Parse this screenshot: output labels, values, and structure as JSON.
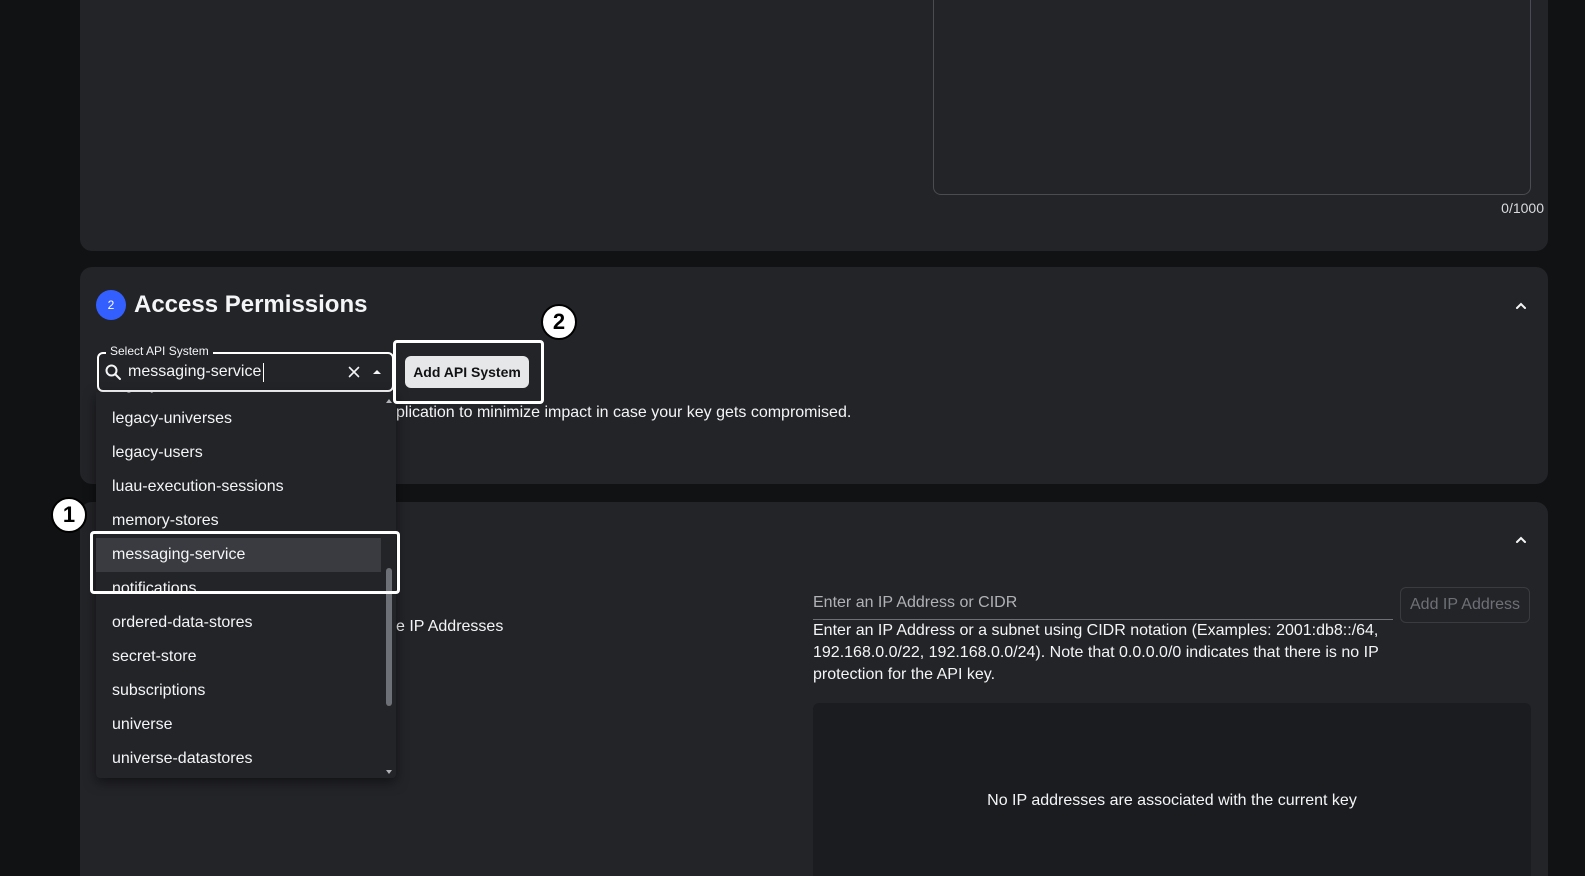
{
  "description_card": {
    "char_count": "0/1000"
  },
  "access_permissions": {
    "step_number": "2",
    "title": "Access Permissions",
    "select_label": "Select API System",
    "select_value": "messaging-service",
    "add_button_label": "Add API System",
    "helper_text": "plication to minimize impact in case your key gets compromised."
  },
  "dropdown": {
    "items": [
      "legacy-team-collaborations",
      "legacy-universes",
      "legacy-users",
      "luau-execution-sessions",
      "memory-stores",
      "messaging-service",
      "notifications",
      "ordered-data-stores",
      "secret-store",
      "subscriptions",
      "universe",
      "universe-datastores"
    ],
    "selected_index": 5
  },
  "ip_section": {
    "partial_label": "e IP Addresses",
    "input_placeholder": "Enter an IP Address or CIDR",
    "add_button_label": "Add IP Address",
    "help_text": "Enter an IP Address or a subnet using CIDR notation (Examples: 2001:db8::/64, 192.168.0.0/22, 192.168.0.0/24). Note that 0.0.0.0/0 indicates that there is no IP protection for the API key.",
    "empty_message": "No IP addresses are associated with the current key"
  },
  "annotations": {
    "marker_1": "1",
    "marker_2": "2"
  },
  "colors": {
    "page_background": "#111214",
    "card_background": "#232428",
    "step_badge": "#335fff",
    "selected_item": "#3a3b40"
  },
  "icons": [
    "search-icon",
    "clear-icon",
    "dropdown-toggle-icon",
    "chevron-up-icon",
    "scroll-arrow-up-icon",
    "scroll-arrow-down-icon"
  ]
}
